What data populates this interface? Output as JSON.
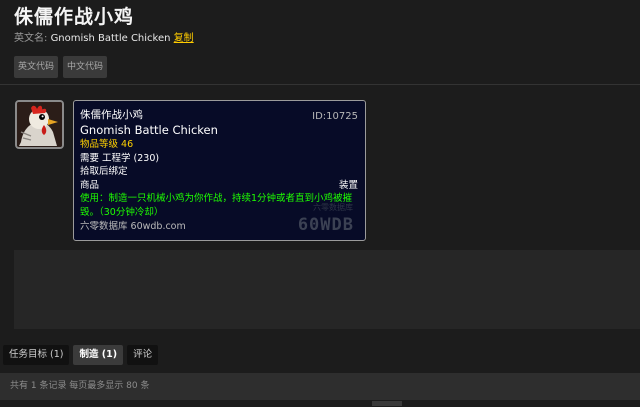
{
  "item": {
    "title": "侏儒作战小鸡",
    "en_label": "英文名:",
    "en_name": "Gnomish Battle Chicken",
    "copy_label": "复制"
  },
  "code_buttons": [
    "英文代码",
    "中文代码"
  ],
  "icon": {
    "name": "chicken-icon"
  },
  "tooltip": {
    "name": "侏儒作战小鸡",
    "name_en": "Gnomish Battle Chicken",
    "id": "ID:10725",
    "item_level": "物品等级 46",
    "requires": "需要 工程学 (230)",
    "binding": "拾取后绑定",
    "type_left": "商品",
    "type_right": "装置",
    "use_text": "使用：制造一只机械小鸡为你作战，持续1分钟或者直到小鸡被摧毁。（30分钟冷却）",
    "site": "六零数据库 60wdb.com",
    "watermark": "60WDB",
    "watermark_small": "六零数据库"
  },
  "tabs": [
    {
      "label": "任务目标 (1)",
      "active": false
    },
    {
      "label": "制造 (1)",
      "active": true
    },
    {
      "label": "评论",
      "active": false
    }
  ],
  "footer": {
    "text": "共有 1 条记录 每页最多显示 80 条"
  },
  "colors": {
    "item_level": "#ffd100",
    "use_text": "#1eff00",
    "tooltip_bg": "#070b27",
    "copy_link": "#ffcc00"
  }
}
